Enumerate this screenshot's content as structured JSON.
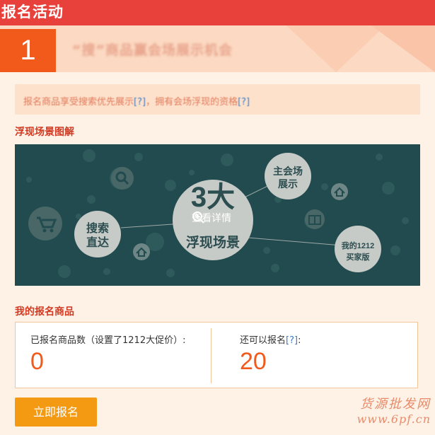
{
  "topbar": {
    "title": "报名活动"
  },
  "hero": {
    "number": "1",
    "headline": "“搜”商品赢会场展示机会"
  },
  "notice": {
    "text": "报名商品享受搜索优先展示",
    "q1": "[?]",
    "mid": "，拥有会场浮现的资格",
    "q2": "[?]"
  },
  "scene_section": {
    "title": "浮现场景图解"
  },
  "scene": {
    "detail_label": "查看详情",
    "center_big": "3大",
    "center_line": "浮现场景",
    "node_search": [
      "搜索",
      "直达"
    ],
    "node_main": [
      "主会场",
      "展示"
    ],
    "node_my": [
      "我的1212",
      "买家版"
    ]
  },
  "goods_section": {
    "title": "我的报名商品"
  },
  "stats": {
    "left_label": "已报名商品数（设置了1212大促价）:",
    "left_value": "0",
    "right_label": "还可以报名",
    "right_q": "[?]",
    "right_colon": ":",
    "right_value": "20"
  },
  "button": {
    "label": "立即报名"
  },
  "watermark": {
    "line1": "货源批发网",
    "line2": "www.6pf.cn"
  },
  "colors": {
    "brand_red": "#e8403a",
    "accent_orange": "#f25a1c",
    "button_orange": "#f49a12",
    "scene_bg": "#214b4e"
  }
}
